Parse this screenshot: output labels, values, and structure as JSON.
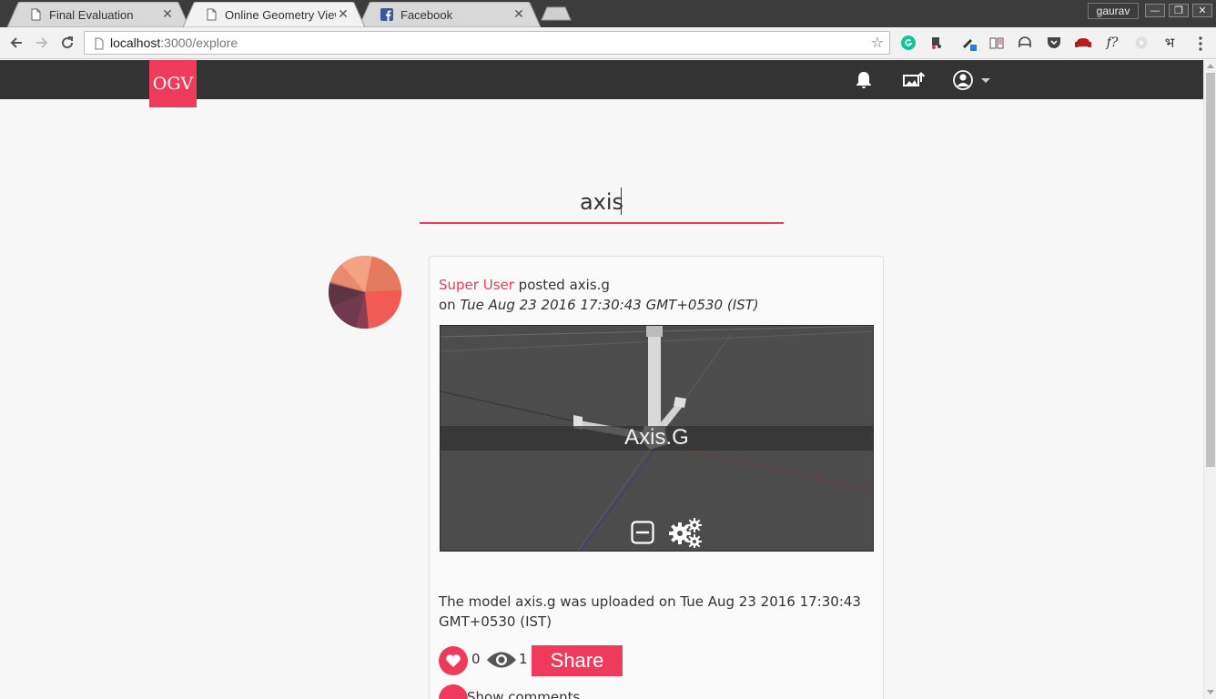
{
  "browser": {
    "tabs": [
      {
        "title": "Final Evaluation",
        "active": false,
        "favicon": "page-icon"
      },
      {
        "title": "Online Geometry View",
        "active": true,
        "favicon": "page-icon"
      },
      {
        "title": "Facebook",
        "active": false,
        "favicon": "facebook-icon"
      }
    ],
    "profile_name": "gaurav",
    "url_host": "localhost",
    "url_path": ":3000/explore",
    "extensions": [
      "grammarly-icon",
      "extension-icon",
      "eyedropper-icon",
      "reader-icon",
      "incognito-icon",
      "pocket-icon",
      "sofa-icon",
      "font-icon",
      "play-icon",
      "hindi-icon"
    ],
    "font_ext_label": "f?",
    "hindi_ext_label": "भ"
  },
  "app": {
    "brand": "OGV",
    "accent_color": "#ef3b5b",
    "navbar_color": "#333333",
    "nav_icons": [
      "bell-icon",
      "upload-icon",
      "user-icon",
      "caret-down-icon"
    ]
  },
  "search": {
    "value": "axis",
    "placeholder": ""
  },
  "post": {
    "user": "Super User",
    "action_text": " posted axis.g",
    "date_prefix": "on ",
    "date": "Tue Aug 23 2016 17:30:43 GMT+0530 (IST)",
    "viewer_title": "Axis.G",
    "description": "The model axis.g was uploaded on Tue Aug 23 2016 17:30:43 GMT+0530 (IST)",
    "likes": "0",
    "views": "1",
    "share_label": "Share",
    "comments_label": "Show comments"
  }
}
